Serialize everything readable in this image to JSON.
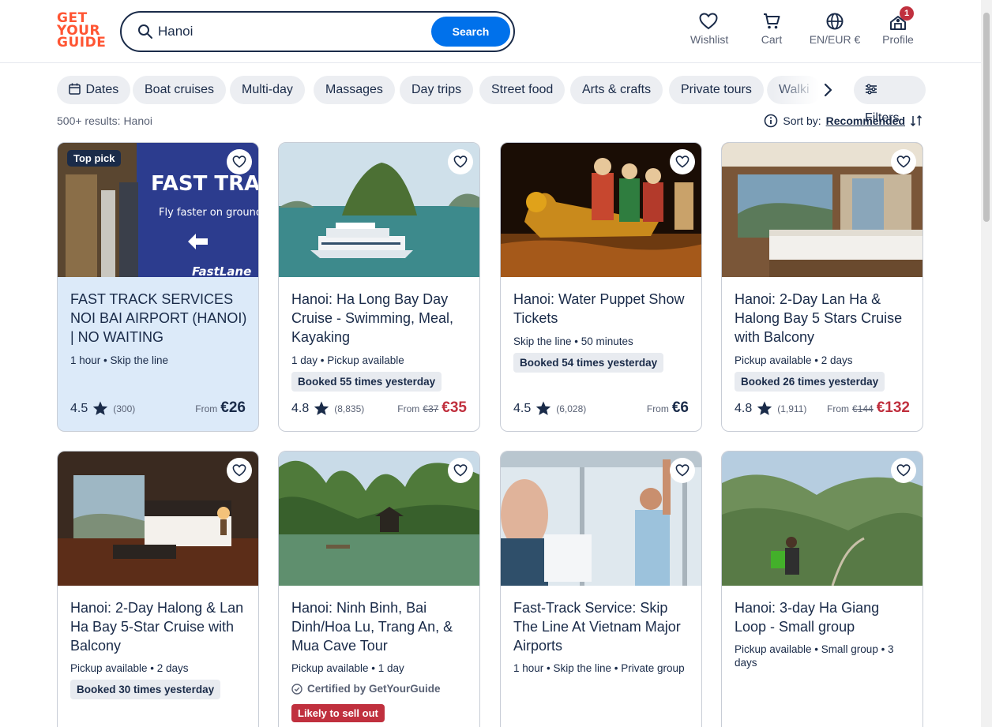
{
  "brand": {
    "logo_lines": [
      "GET",
      "YOUR",
      "GUIDE"
    ],
    "accent": "#ff5533",
    "primary": "#0071eb"
  },
  "search": {
    "value": "Hanoi",
    "button": "Search"
  },
  "nav": {
    "wishlist": "Wishlist",
    "cart": "Cart",
    "language": "EN/EUR €",
    "profile": "Profile",
    "profile_badge": "1"
  },
  "chips": [
    "Dates",
    "Boat cruises",
    "Multi-day",
    "Massages",
    "Day trips",
    "Street food",
    "Arts & crafts",
    "Private tours",
    "Walki"
  ],
  "filters_label": "Filters",
  "results_label": "500+ results: Hanoi",
  "sort": {
    "label": "Sort by:",
    "value": "Recommended"
  },
  "cards": [
    {
      "title": "FAST TRACK SERVICES NOI BAI AIRPORT (HANOI) | NO WAITING",
      "meta": "1 hour • Skip the line",
      "tag": "Top pick",
      "rating": "4.5",
      "reviews": "(300)",
      "from": "From",
      "price": "€26"
    },
    {
      "title": "Hanoi: Ha Long Bay Day Cruise - Swimming, Meal, Kayaking",
      "meta": "1 day • Pickup available",
      "booked": "Booked 55 times yesterday",
      "rating": "4.8",
      "reviews": "(8,835)",
      "from": "From",
      "old_price": "€37",
      "price": "€35"
    },
    {
      "title": "Hanoi: Water Puppet Show Tickets",
      "meta": "Skip the line • 50 minutes",
      "booked": "Booked 54 times yesterday",
      "rating": "4.5",
      "reviews": "(6,028)",
      "from": "From",
      "price": "€6"
    },
    {
      "title": "Hanoi: 2-Day Lan Ha & Halong Bay 5 Stars Cruise with Balcony",
      "meta": "Pickup available • 2 days",
      "booked": "Booked 26 times yesterday",
      "rating": "4.8",
      "reviews": "(1,911)",
      "from": "From",
      "old_price": "€144",
      "price": "€132"
    },
    {
      "title": "Hanoi: 2-Day Halong & Lan Ha Bay 5-Star Cruise with Balcony",
      "meta": "Pickup available • 2 days",
      "booked": "Booked 30 times yesterday"
    },
    {
      "title": "Hanoi: Ninh Binh, Bai Dinh/Hoa Lu, Trang An, & Mua Cave Tour",
      "meta": "Pickup available • 1 day",
      "certified": "Certified by GetYourGuide",
      "sellout": "Likely to sell out"
    },
    {
      "title": "Fast-Track Service: Skip The Line At Vietnam Major Airports",
      "meta": "1 hour • Skip the line • Private group"
    },
    {
      "title": "Hanoi: 3-day Ha Giang Loop - Small group",
      "meta": "Pickup available • Small group • 3 days"
    }
  ],
  "image_text": {
    "fast_track": "FAST TRACK",
    "fly_faster": "Fly faster on ground",
    "fastlane": "FastLane"
  }
}
